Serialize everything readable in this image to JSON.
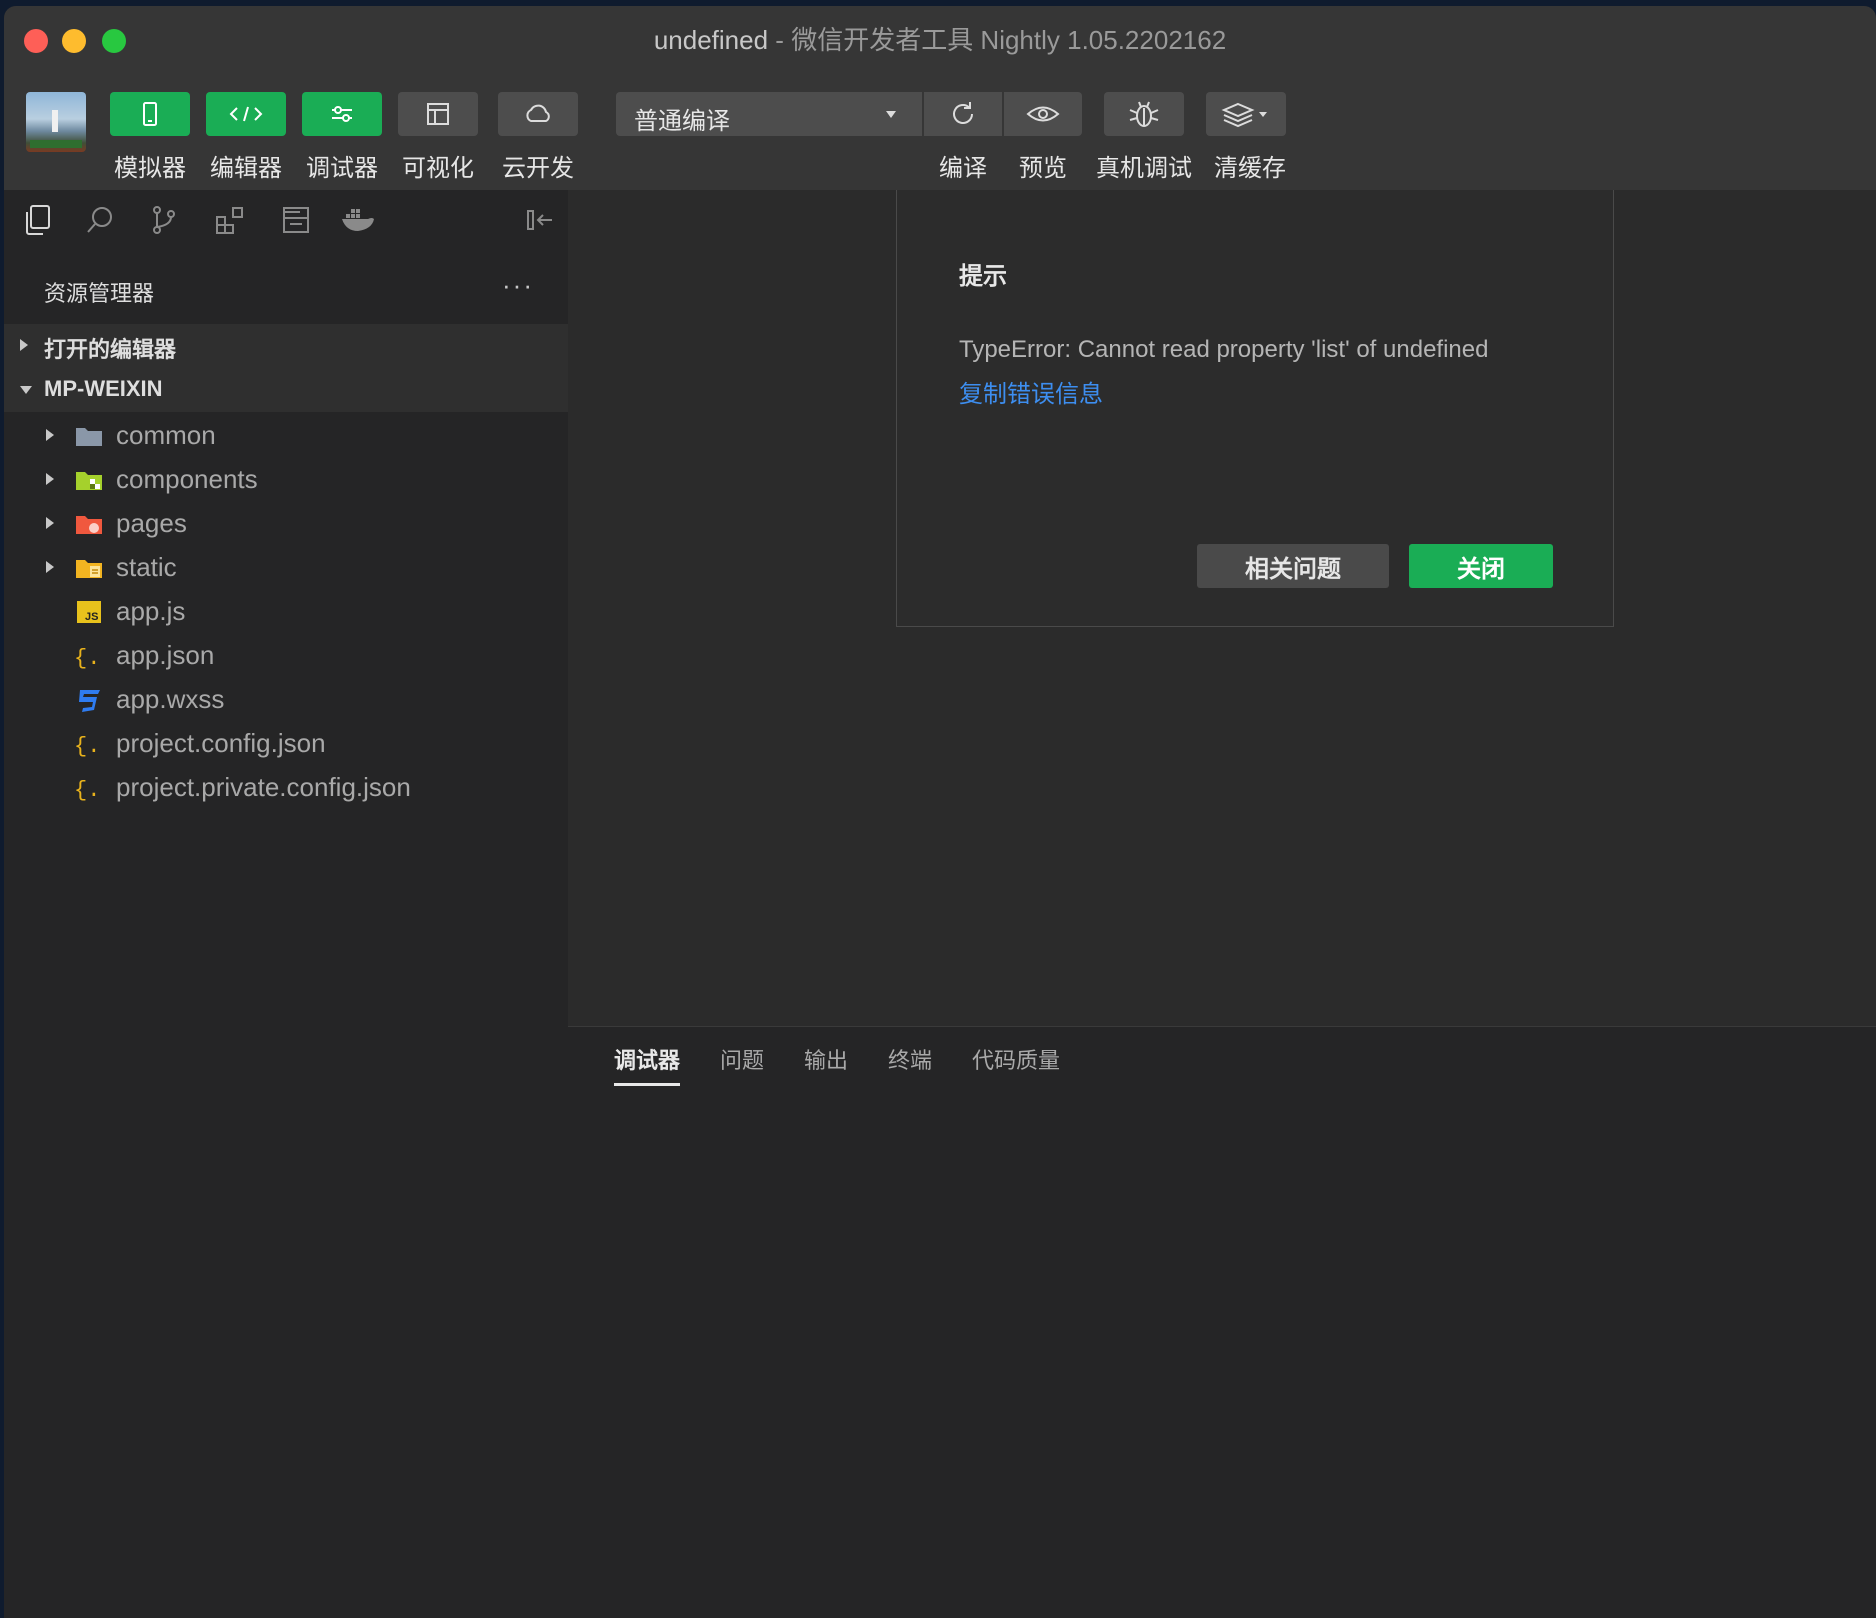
{
  "window": {
    "title_project": "undefined",
    "title_separator": " - ",
    "title_app": "微信开发者工具 Nightly 1.05.2202162"
  },
  "toolbar": {
    "simulator": "模拟器",
    "editor": "编辑器",
    "debugger": "调试器",
    "visual": "可视化",
    "cloud": "云开发",
    "compile_mode": "普通编译",
    "compile": "编译",
    "preview": "预览",
    "remote_debug": "真机调试",
    "clear_cache": "清缓存"
  },
  "sidebar": {
    "icons": [
      "files-icon",
      "search-icon",
      "source-control-icon",
      "extensions-icon",
      "storage-icon",
      "docker-icon",
      "collapse-panel-icon"
    ],
    "explorer_title": "资源管理器",
    "more": "···",
    "open_editors": "打开的编辑器",
    "project_root": "MP-WEIXIN",
    "tree": [
      {
        "name": "common",
        "icon": "folder-icon",
        "color": "#8a97a8",
        "expandable": true
      },
      {
        "name": "components",
        "icon": "components-folder-icon",
        "color": "#a5d12c",
        "expandable": true
      },
      {
        "name": "pages",
        "icon": "pages-folder-icon",
        "color": "#f0583e",
        "expandable": true
      },
      {
        "name": "static",
        "icon": "static-folder-icon",
        "color": "#f2b421",
        "expandable": true
      },
      {
        "name": "app.js",
        "icon": "js-file-icon",
        "color": "#e8c21c",
        "expandable": false
      },
      {
        "name": "app.json",
        "icon": "json-file-icon",
        "color": "#e8b21c",
        "expandable": false
      },
      {
        "name": "app.wxss",
        "icon": "css-file-icon",
        "color": "#2f7cf0",
        "expandable": false
      },
      {
        "name": "project.config.json",
        "icon": "json-file-icon",
        "color": "#e8b21c",
        "expandable": false
      },
      {
        "name": "project.private.config.json",
        "icon": "json-file-icon",
        "color": "#e8b21c",
        "expandable": false
      }
    ]
  },
  "dialog": {
    "title": "提示",
    "message": "TypeError: Cannot read property 'list' of undefined",
    "copy_link": "复制错误信息",
    "related_button": "相关问题",
    "close_button": "关闭"
  },
  "panel": {
    "tabs": [
      "调试器",
      "问题",
      "输出",
      "终端",
      "代码质量"
    ],
    "active_tab": "调试器"
  },
  "colors": {
    "accent_green": "#1aad55",
    "link_blue": "#3d8ef0"
  }
}
